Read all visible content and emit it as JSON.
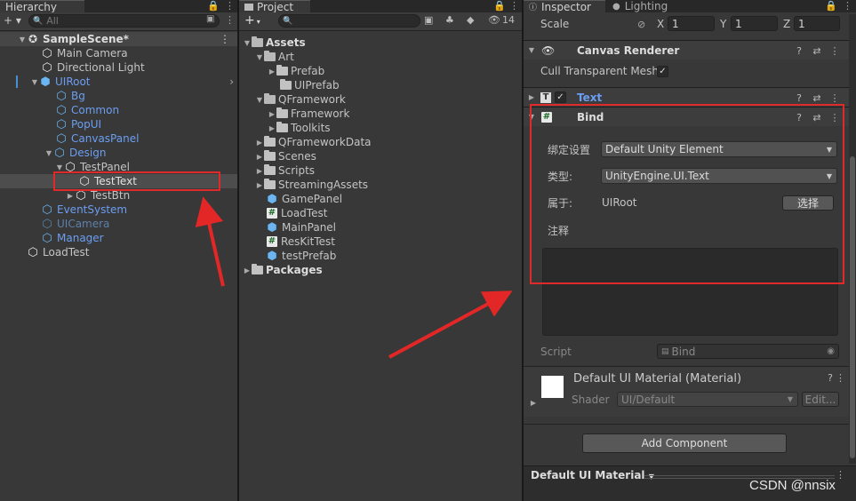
{
  "hierarchy": {
    "tab_label": "Hierarchy",
    "search_placeholder": "All",
    "scene_name": "SampleScene*",
    "items": [
      {
        "label": "Main Camera"
      },
      {
        "label": "Directional Light"
      },
      {
        "label": "UIRoot"
      },
      {
        "label": "Bg"
      },
      {
        "label": "Common"
      },
      {
        "label": "PopUI"
      },
      {
        "label": "CanvasPanel"
      },
      {
        "label": "Design"
      },
      {
        "label": "TestPanel"
      },
      {
        "label": "TestText"
      },
      {
        "label": "TestBtn"
      },
      {
        "label": "EventSystem"
      },
      {
        "label": "UICamera"
      },
      {
        "label": "Manager"
      },
      {
        "label": "LoadTest"
      }
    ]
  },
  "project": {
    "tab_label": "Project",
    "add_label": "+",
    "hidden_count": "14",
    "items": [
      {
        "label": "Assets"
      },
      {
        "label": "Art"
      },
      {
        "label": "Prefab"
      },
      {
        "label": "UIPrefab"
      },
      {
        "label": "QFramework"
      },
      {
        "label": "Framework"
      },
      {
        "label": "Toolkits"
      },
      {
        "label": "QFrameworkData"
      },
      {
        "label": "Scenes"
      },
      {
        "label": "Scripts"
      },
      {
        "label": "StreamingAssets"
      },
      {
        "label": "GamePanel"
      },
      {
        "label": "LoadTest"
      },
      {
        "label": "MainPanel"
      },
      {
        "label": "ResKitTest"
      },
      {
        "label": "testPrefab"
      },
      {
        "label": "Packages"
      }
    ]
  },
  "inspector": {
    "tab_inspector": "Inspector",
    "tab_lighting": "Lighting",
    "scale_label": "Scale",
    "scale_x_label": "X",
    "scale_x": "1",
    "scale_y_label": "Y",
    "scale_y": "1",
    "scale_z_label": "Z",
    "scale_z": "1",
    "canvas_renderer": "Canvas Renderer",
    "cull_label": "Cull Transparent Mesh",
    "text_component": "Text",
    "bind_component": "Bind",
    "bind_setting_label": "绑定设置",
    "bind_setting_value": "Default Unity Element",
    "type_label": "类型:",
    "type_value": "UnityEngine.UI.Text",
    "belong_label": "属于:",
    "belong_value": "UIRoot",
    "select_button": "选择",
    "comment_label": "注释",
    "script_label": "Script",
    "script_value": "Bind",
    "material_name": "Default UI Material (Material)",
    "shader_label": "Shader",
    "shader_value": "UI/Default",
    "edit_button": "Edit...",
    "add_component": "Add Component",
    "preview_label": "Default UI Material"
  },
  "watermark": "CSDN @nnsix"
}
